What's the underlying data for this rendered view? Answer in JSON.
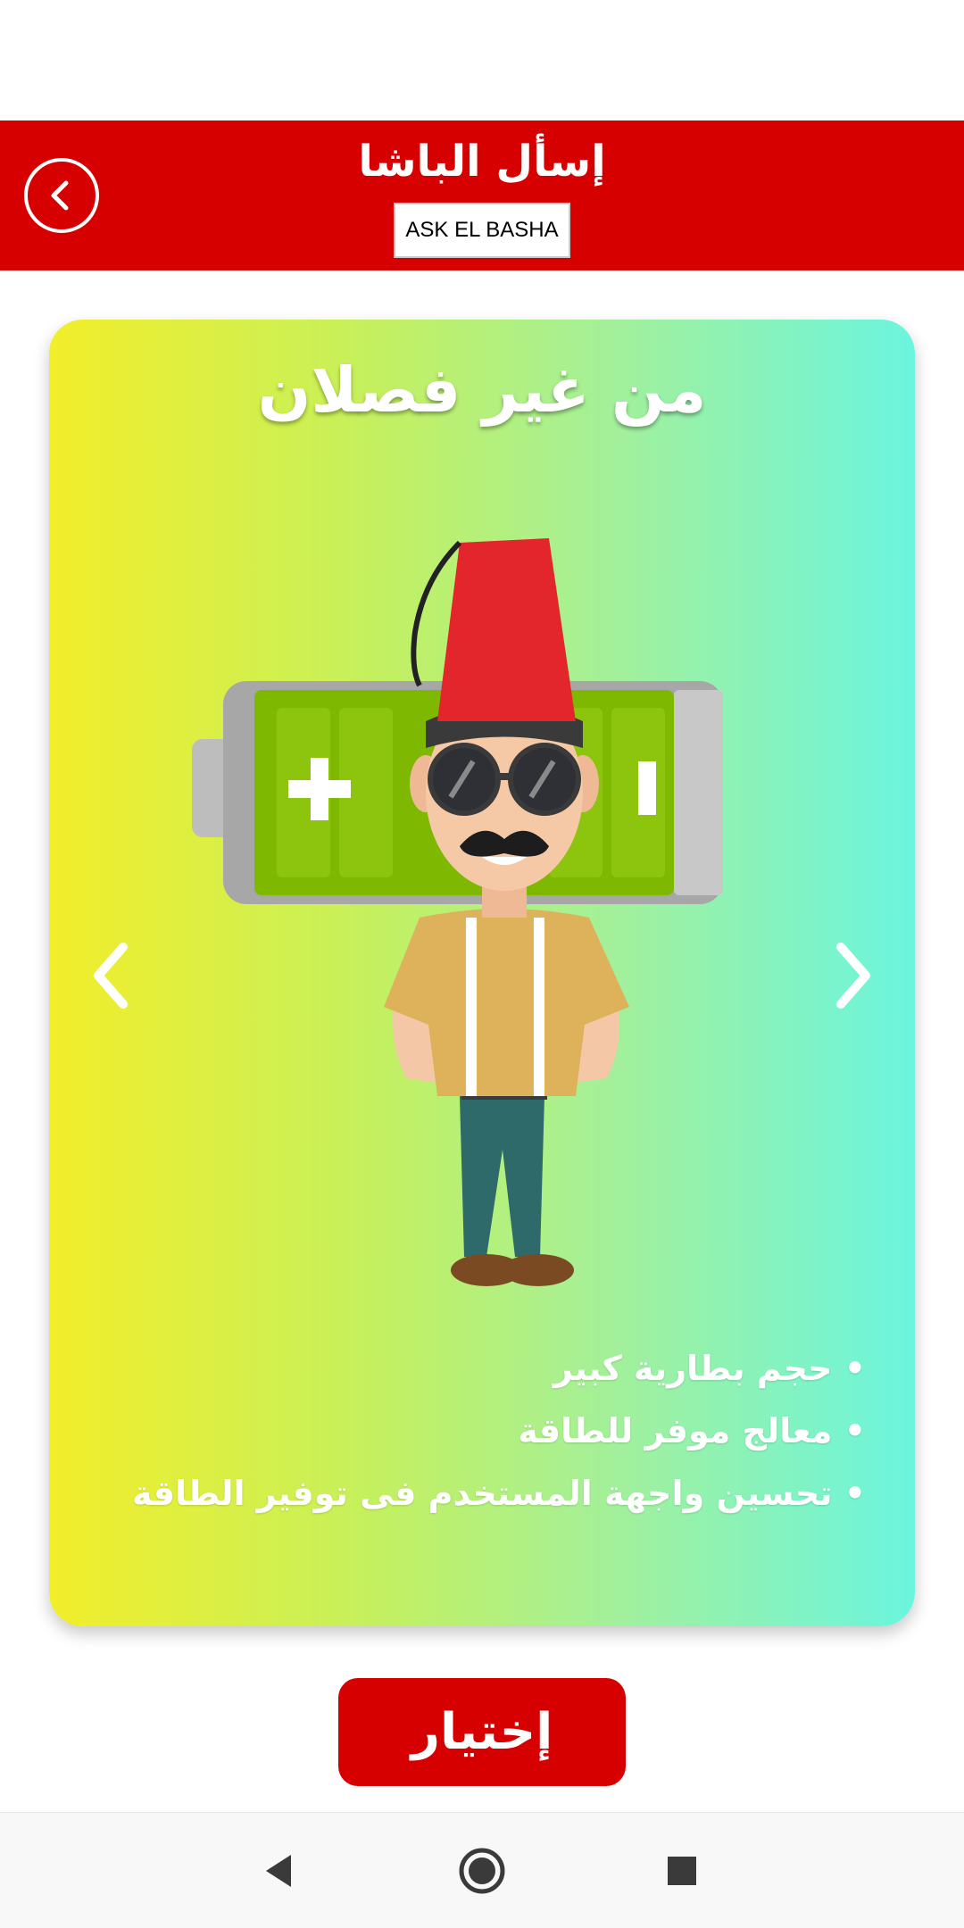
{
  "app_bar": {
    "title": "إسأل الباشا",
    "subtitle": "ASK EL BASHA",
    "back_icon": "back-circle-icon"
  },
  "card": {
    "title": "من غير فصلان",
    "features": [
      "حجم بطارية كبير",
      "معالج موفر للطاقة",
      "تحسين واجهة المستخدم فى توفير الطاقة"
    ],
    "prev_icon": "chevron-left-icon",
    "next_icon": "chevron-right-icon"
  },
  "choose_button": {
    "label": "إختيار"
  },
  "system_nav": {
    "back": "triangle-back-icon",
    "home": "circle-home-icon",
    "recents": "square-recents-icon"
  },
  "colors": {
    "primary": "#d60000",
    "gradient_start": "#f2ee2a",
    "gradient_end": "#6bf5de"
  }
}
